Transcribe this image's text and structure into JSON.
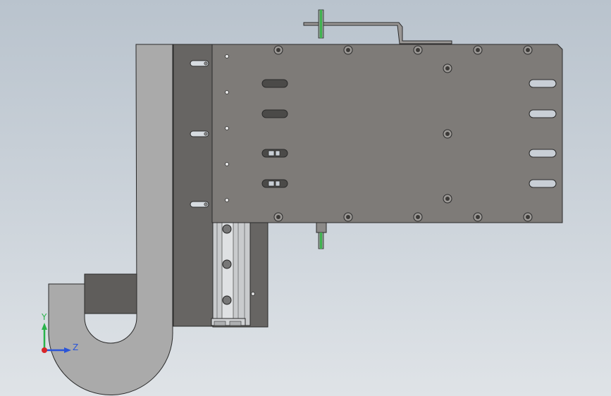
{
  "viewport": {
    "background_top": "#b9c3cd",
    "background_bottom": "#dfe3e7"
  },
  "model": {
    "colors": {
      "plate": "#7e7b78",
      "edge": "#2a2a2a",
      "slot": "#c9cfd6",
      "carriage": "#676563",
      "profile": "#aaaaaa",
      "rail": "#c9cbcd",
      "cable_gland": "#5f5d5b",
      "sensor": "#3fb34f"
    },
    "icons": [
      "screw-head-icon",
      "slot-icon",
      "sensor-icon"
    ]
  },
  "triad": {
    "y_label": "Y",
    "z_label": "Z",
    "y_color": "#29b34a",
    "z_color": "#2a55d8",
    "x_color": "#d8262a"
  }
}
